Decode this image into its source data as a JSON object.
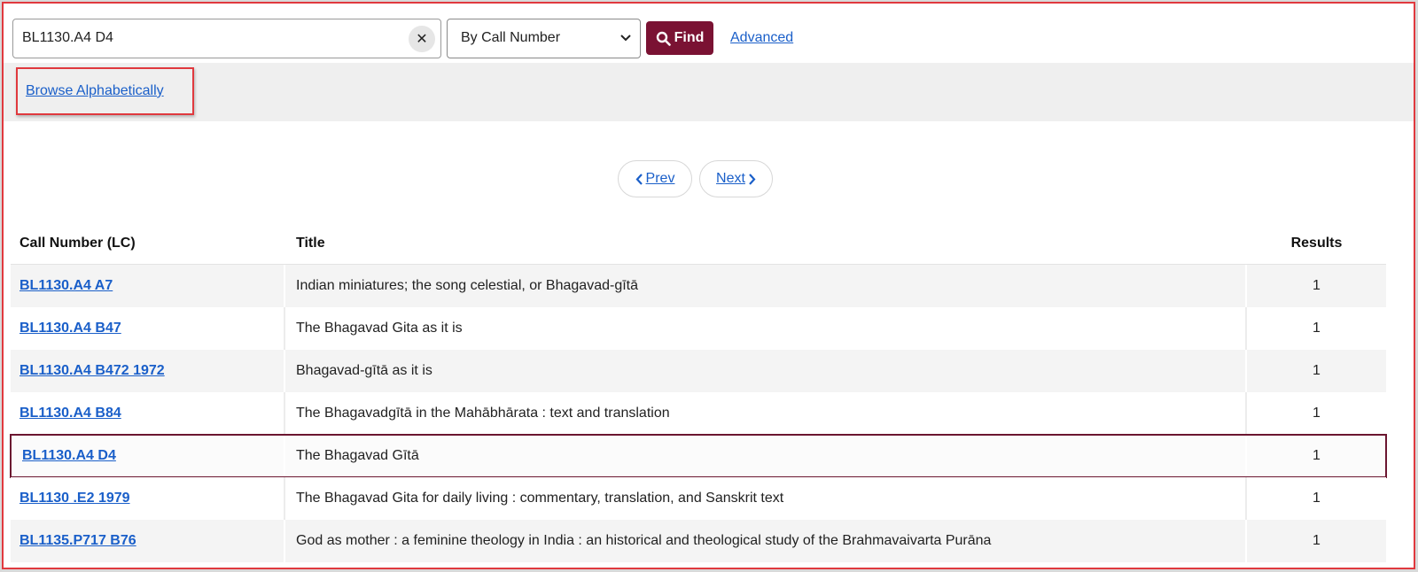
{
  "search": {
    "query": "BL1130.A4 D4",
    "clear_glyph": "✕",
    "mode": "By Call Number",
    "find_label": "Find",
    "advanced_label": "Advanced"
  },
  "browse": {
    "label": "Browse Alphabetically"
  },
  "pager": {
    "prev_label": "Prev",
    "next_label": "Next"
  },
  "table": {
    "headers": [
      "Call Number (LC)",
      "Title",
      "Results"
    ],
    "rows": [
      {
        "call": "BL1130.A4 A7",
        "title": "Indian miniatures; the song celestial, or Bhagavad-gītā",
        "results": "1"
      },
      {
        "call": "BL1130.A4 B47",
        "title": "The Bhagavad Gita as it is",
        "results": "1"
      },
      {
        "call": "BL1130.A4 B472 1972",
        "title": "Bhagavad-gītā as it is",
        "results": "1"
      },
      {
        "call": "BL1130.A4 B84",
        "title": "The Bhagavadgītā in the Mahābhārata : text and translation",
        "results": "1"
      },
      {
        "call": "BL1130.A4 D4",
        "title": "The Bhagavad Gītā",
        "results": "1"
      },
      {
        "call": "BL1130 .E2 1979",
        "title": "The Bhagavad Gita for daily living : commentary, translation, and Sanskrit text",
        "results": "1"
      },
      {
        "call": "BL1135.P717 B76",
        "title": "God as mother : a feminine theology in India : an historical and theological study of the Brahmavaivarta Purāna",
        "results": "1"
      }
    ]
  },
  "colors": {
    "accent": "#7a1233",
    "link": "#1a5fc9",
    "highlight_border": "#e0393e"
  }
}
